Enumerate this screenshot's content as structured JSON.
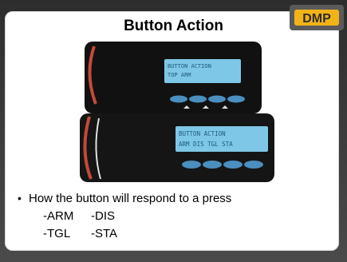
{
  "slide": {
    "title": "Button Action",
    "logo_text": "DMP",
    "lcd_top": {
      "line1": "BUTTON ACTION",
      "line2": "TOP ARM"
    },
    "lcd_bottom": {
      "line1": "BUTTON ACTION",
      "line2": "ARM DIS TGL STA"
    },
    "bullet": "How the button will respond to a press",
    "options": [
      [
        "-ARM",
        "-DIS"
      ],
      [
        "-TGL",
        "-STA"
      ]
    ]
  },
  "colors": {
    "background": "#3a3a3a",
    "lcd": "#7ec7e6",
    "logo": "#f2b318"
  }
}
